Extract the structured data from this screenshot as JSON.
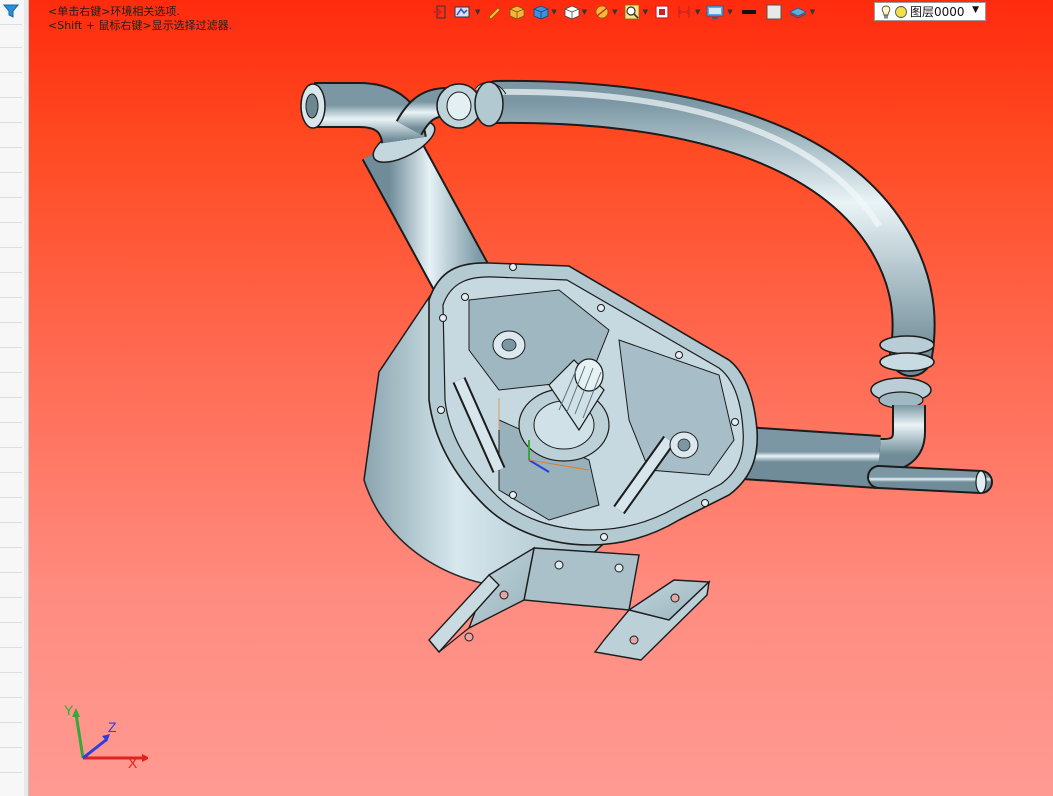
{
  "hints": {
    "line1": "<单击右键>环境相关选项.",
    "line2": "<Shift + 鼠标右键>显示选择过滤器."
  },
  "toolbar": {
    "icons": [
      "view-orient-icon",
      "render-style-icon",
      "pen-icon",
      "box-shaded-icon",
      "box-blue-icon",
      "cube-white-icon",
      "section-icon",
      "zoom-icon",
      "fit-icon",
      "ruler-icon",
      "display-icon",
      "line-color-icon",
      "fill-color-icon",
      "layer-tool-icon"
    ],
    "layer": {
      "label": "图层0000"
    }
  },
  "triad": {
    "x": "X",
    "y": "Y",
    "z": "Z"
  },
  "colors": {
    "bg_top": "#ff2b0e",
    "bg_bottom": "#ff9a92",
    "part_fill": "#a9c3cd",
    "part_edge": "#1c1c1c",
    "axis_x": "#e0231c",
    "axis_y": "#3aa63a",
    "axis_z": "#2a3fe0"
  }
}
